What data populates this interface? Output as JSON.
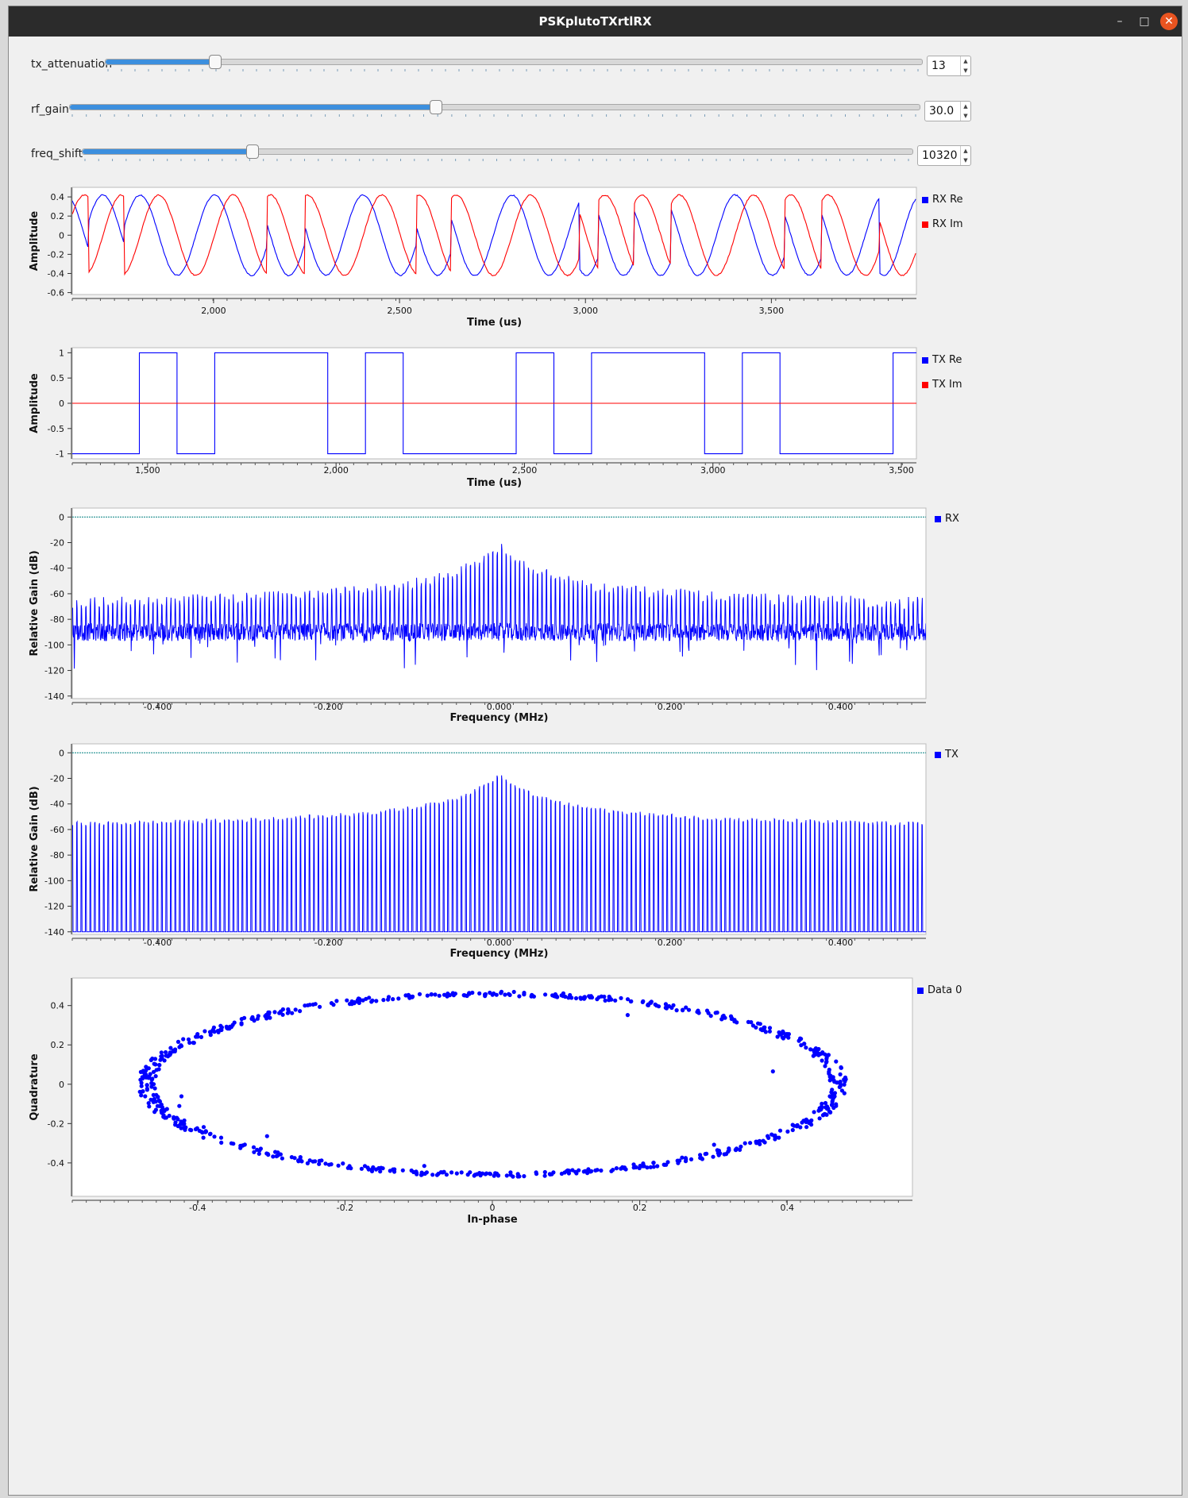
{
  "window": {
    "title": "PSKplutoTXrtlRX",
    "min_icon": "minimize-icon",
    "max_icon": "maximize-icon",
    "close_icon": "close-icon"
  },
  "controls": [
    {
      "id": "tx_attenuation",
      "label": "tx_attenuation",
      "value": "13",
      "fraction": 0.133
    },
    {
      "id": "rf_gain",
      "label": "rf_gain",
      "value": "30.0",
      "fraction": 0.43
    },
    {
      "id": "freq_shift",
      "label": "freq_shift",
      "value": "10320",
      "fraction": 0.204
    }
  ],
  "colors": {
    "blue": "#0000ff",
    "red": "#ff0000",
    "accent": "#3c8fde",
    "ref_line": "#008080"
  },
  "plots": [
    {
      "id": "rx-time",
      "xlabel": "Time (us)",
      "ylabel": "Amplitude",
      "legend": [
        {
          "name": "RX Re",
          "color": "#0000ff"
        },
        {
          "name": "RX Im",
          "color": "#ff0000"
        }
      ]
    },
    {
      "id": "tx-time",
      "xlabel": "Time (us)",
      "ylabel": "Amplitude",
      "legend": [
        {
          "name": "TX Re",
          "color": "#0000ff"
        },
        {
          "name": "TX Im",
          "color": "#ff0000"
        }
      ]
    },
    {
      "id": "rx-freq",
      "xlabel": "Frequency (MHz)",
      "ylabel": "Relative Gain (dB)",
      "legend": [
        {
          "name": "RX",
          "color": "#0000ff"
        }
      ]
    },
    {
      "id": "tx-freq",
      "xlabel": "Frequency (MHz)",
      "ylabel": "Relative Gain (dB)",
      "legend": [
        {
          "name": "TX",
          "color": "#0000ff"
        }
      ]
    },
    {
      "id": "constellation",
      "xlabel": "In-phase",
      "ylabel": "Quadrature",
      "legend": [
        {
          "name": "Data 0",
          "color": "#0000ff"
        }
      ]
    }
  ],
  "chart_data": [
    {
      "type": "line",
      "title": "",
      "xlabel": "Time (us)",
      "ylabel": "Amplitude",
      "xlim": [
        1620,
        3890
      ],
      "ylim": [
        -0.62,
        0.5
      ],
      "x_ticks": [
        "2,000",
        "2,500",
        "3,000",
        "3,500"
      ],
      "x_tick_values": [
        2000,
        2500,
        3000,
        3500
      ],
      "y_ticks": [
        "0.4",
        "0.2",
        "0",
        "-0.2",
        "-0.4",
        "-0.6"
      ],
      "y_tick_values": [
        0.4,
        0.2,
        0,
        -0.2,
        -0.4,
        -0.6
      ],
      "legend_position": "right",
      "series": [
        {
          "name": "RX Re",
          "color": "#0000ff",
          "amplitude": 0.42,
          "period_us": 200,
          "phase_jumps_us": [
            1665,
            1760,
            2145,
            2245,
            2545,
            2640,
            2985,
            3035,
            3130,
            3230,
            3535,
            3635,
            3790
          ]
        },
        {
          "name": "RX Im",
          "color": "#ff0000",
          "amplitude": 0.42,
          "period_us": 200,
          "phase_jumps_us": [
            1665,
            1760,
            2145,
            2245,
            2545,
            2640,
            2985,
            3035,
            3130,
            3230,
            3535,
            3635,
            3790
          ]
        }
      ]
    },
    {
      "type": "line",
      "title": "",
      "xlabel": "Time (us)",
      "ylabel": "Amplitude",
      "xlim": [
        1300,
        3540
      ],
      "ylim": [
        -1.1,
        1.1
      ],
      "x_ticks": [
        "1,500",
        "2,000",
        "2,500",
        "3,000",
        "3,500"
      ],
      "x_tick_values": [
        1500,
        2000,
        2500,
        3000,
        3500
      ],
      "y_ticks": [
        "1",
        "0.5",
        "0",
        "-0.5",
        "-1"
      ],
      "y_tick_values": [
        1,
        0.5,
        0,
        -0.5,
        -1
      ],
      "legend_position": "right",
      "series": [
        {
          "name": "TX Re",
          "color": "#0000ff",
          "x": [
            1300,
            1478,
            1478,
            1578,
            1578,
            1678,
            1678,
            1978,
            1978,
            2078,
            2078,
            2178,
            2178,
            2478,
            2478,
            2578,
            2578,
            2678,
            2678,
            2978,
            2978,
            3078,
            3078,
            3178,
            3178,
            3478,
            3478,
            3540
          ],
          "y": [
            -1,
            -1,
            1,
            1,
            -1,
            -1,
            1,
            1,
            -1,
            -1,
            1,
            1,
            -1,
            -1,
            1,
            1,
            -1,
            -1,
            1,
            1,
            -1,
            -1,
            1,
            1,
            -1,
            -1,
            1,
            1
          ]
        },
        {
          "name": "TX Im",
          "color": "#ff0000",
          "x": [
            1300,
            3540
          ],
          "y": [
            0,
            0
          ]
        }
      ]
    },
    {
      "type": "line",
      "title": "",
      "xlabel": "Frequency (MHz)",
      "ylabel": "Relative Gain (dB)",
      "xlim": [
        -0.5,
        0.5
      ],
      "ylim": [
        -142,
        7
      ],
      "x_ticks": [
        "-0.400",
        "-0.200",
        "0.000",
        "0.200",
        "0.400"
      ],
      "x_tick_values": [
        -0.4,
        -0.2,
        0,
        0.2,
        0.4
      ],
      "y_ticks": [
        "0",
        "-20",
        "-40",
        "-60",
        "-80",
        "-100",
        "-120",
        "-140"
      ],
      "y_tick_values": [
        0,
        -20,
        -40,
        -60,
        -80,
        -100,
        -120,
        -140
      ],
      "reference_line_db": 0,
      "legend_position": "right",
      "series": [
        {
          "name": "RX",
          "color": "#0000ff",
          "noise_floor_db": -90,
          "peak_db": -24,
          "edge_peak_db": -70,
          "min_db": -130,
          "spike_spacing_mhz": 0.005
        }
      ]
    },
    {
      "type": "line",
      "title": "",
      "xlabel": "Frequency (MHz)",
      "ylabel": "Relative Gain (dB)",
      "xlim": [
        -0.5,
        0.5
      ],
      "ylim": [
        -142,
        7
      ],
      "x_ticks": [
        "-0.400",
        "-0.200",
        "0.000",
        "0.200",
        "0.400"
      ],
      "x_tick_values": [
        -0.4,
        -0.2,
        0,
        0.2,
        0.4
      ],
      "y_ticks": [
        "0",
        "-20",
        "-40",
        "-60",
        "-80",
        "-100",
        "-120",
        "-140"
      ],
      "y_tick_values": [
        0,
        -20,
        -40,
        -60,
        -80,
        -100,
        -120,
        -140
      ],
      "reference_line_db": 0,
      "legend_position": "right",
      "series": [
        {
          "name": "TX",
          "color": "#0000ff",
          "floor_db": -140,
          "peak_db": -18,
          "edge_peak_db": -58,
          "spike_spacing_mhz": 0.005
        }
      ]
    },
    {
      "type": "scatter",
      "title": "",
      "xlabel": "In-phase",
      "ylabel": "Quadrature",
      "xlim": [
        -0.57,
        0.57
      ],
      "ylim": [
        -0.57,
        0.54
      ],
      "x_ticks": [
        "-0.4",
        "-0.2",
        "0",
        "0.2",
        "0.4"
      ],
      "x_tick_values": [
        -0.4,
        -0.2,
        0,
        0.2,
        0.4
      ],
      "y_ticks": [
        "0.4",
        "0.2",
        "0",
        "-0.2",
        "-0.4"
      ],
      "y_tick_values": [
        0.4,
        0.2,
        0,
        -0.2,
        -0.4
      ],
      "legend_position": "right",
      "series": [
        {
          "name": "Data 0",
          "color": "#0000ff",
          "shape": "ellipse",
          "radius_i": 0.47,
          "radius_q": 0.46,
          "points": 720
        }
      ]
    }
  ]
}
